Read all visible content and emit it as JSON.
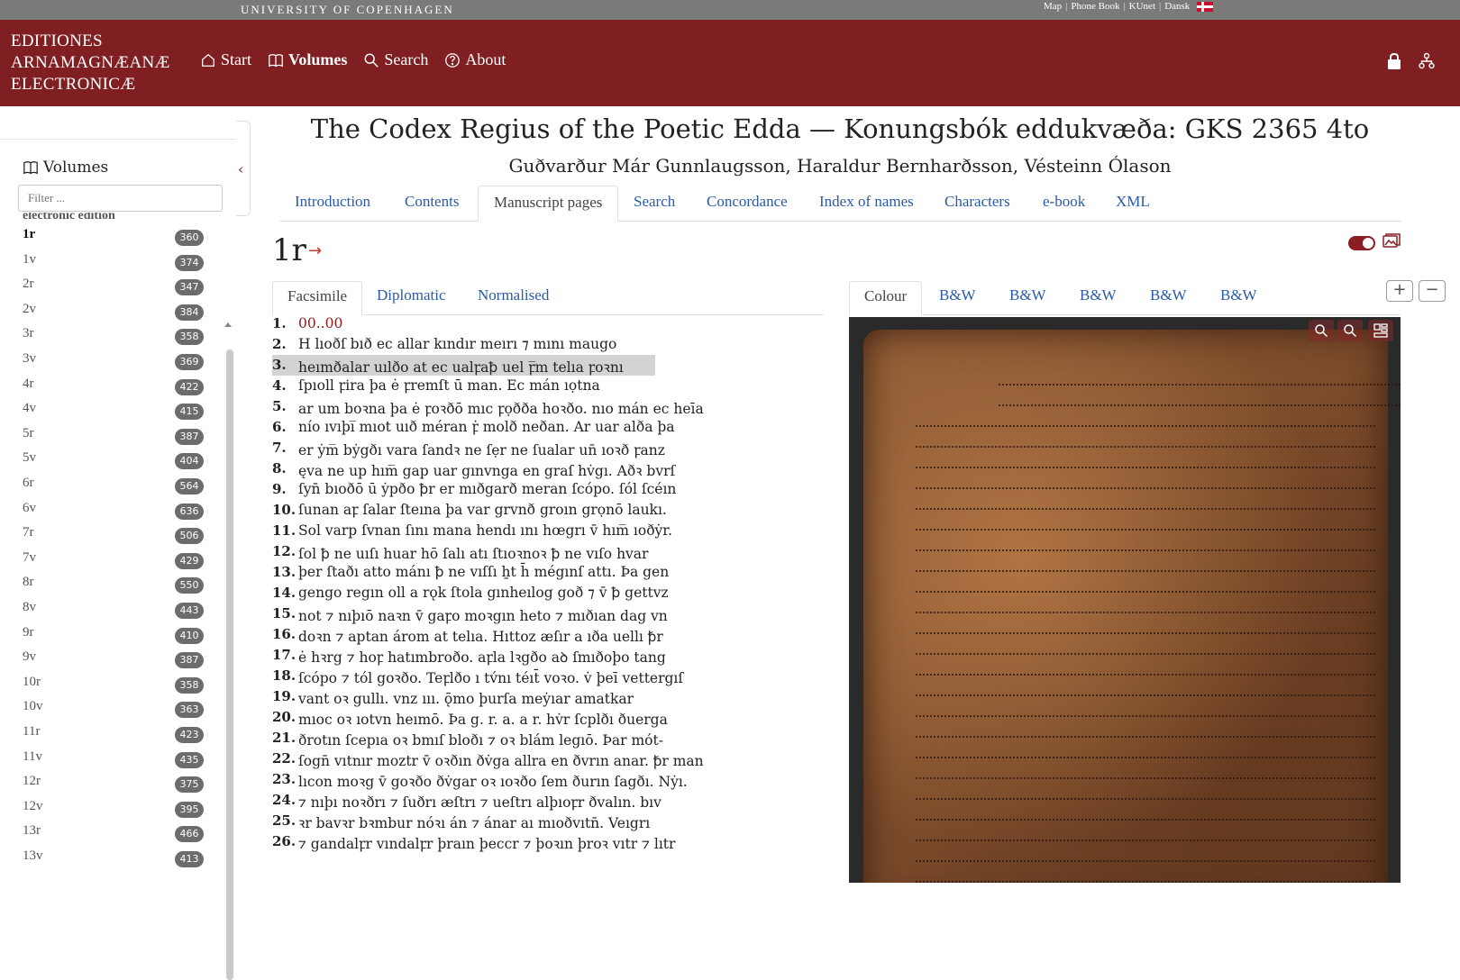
{
  "top": {
    "university": "UNIVERSITY OF COPENHAGEN",
    "links": [
      "Map",
      "Phone Book",
      "KUnet",
      "Dansk"
    ]
  },
  "header": {
    "brand_lines": [
      "EDITIONES",
      "ARNAMAGNÆANÆ",
      "ELECTRONICÆ"
    ],
    "nav": [
      "Start",
      "Volumes",
      "Search",
      "About"
    ]
  },
  "sidebar": {
    "title": "Volumes",
    "filter_placeholder": "Filter ...",
    "section": "electronic edition",
    "pages": [
      {
        "label": "1r",
        "count": "360"
      },
      {
        "label": "1v",
        "count": "374"
      },
      {
        "label": "2r",
        "count": "347"
      },
      {
        "label": "2v",
        "count": "384"
      },
      {
        "label": "3r",
        "count": "358"
      },
      {
        "label": "3v",
        "count": "369"
      },
      {
        "label": "4r",
        "count": "422"
      },
      {
        "label": "4v",
        "count": "415"
      },
      {
        "label": "5r",
        "count": "387"
      },
      {
        "label": "5v",
        "count": "404"
      },
      {
        "label": "6r",
        "count": "564"
      },
      {
        "label": "6v",
        "count": "636"
      },
      {
        "label": "7r",
        "count": "506"
      },
      {
        "label": "7v",
        "count": "429"
      },
      {
        "label": "8r",
        "count": "550"
      },
      {
        "label": "8v",
        "count": "443"
      },
      {
        "label": "9r",
        "count": "410"
      },
      {
        "label": "9v",
        "count": "387"
      },
      {
        "label": "10r",
        "count": "358"
      },
      {
        "label": "10v",
        "count": "363"
      },
      {
        "label": "11r",
        "count": "423"
      },
      {
        "label": "11v",
        "count": "435"
      },
      {
        "label": "12r",
        "count": "375"
      },
      {
        "label": "12v",
        "count": "395"
      },
      {
        "label": "13r",
        "count": "466"
      },
      {
        "label": "13v",
        "count": "413"
      }
    ]
  },
  "document": {
    "title": "The Codex Regius of the Poetic Edda — Konungsbók eddukvæða: GKS 2365 4to",
    "authors": "Guðvarður Már Gunnlaugsson, Haraldur Bernharðsson, Vésteinn Ólason",
    "tabs": [
      "Introduction",
      "Contents",
      "Manuscript pages",
      "Search",
      "Concordance",
      "Index of names",
      "Characters",
      "e-book",
      "XML"
    ],
    "page": "1r",
    "page_arrow": "→",
    "text_tabs": [
      "Facsimile",
      "Diplomatic",
      "Normalised"
    ],
    "image_tabs": [
      "Colour",
      "B&W",
      "B&W",
      "B&W",
      "B&W",
      "B&W"
    ],
    "zoom_in": "+",
    "zoom_out": "−"
  },
  "lines": [
    {
      "n": "1.",
      "t": "00..00"
    },
    {
      "n": "2.",
      "t": "H lıoðſ bıð ec allar kındır meırı ⁊ mını maugo"
    },
    {
      "n": "3.",
      "t": "heımðalar uılðo at ec ualꝼaꝥ uel ꝼ̅m telıa ꝼoꝛnı"
    },
    {
      "n": "4.",
      "t": "ſpıoll ꝼira þa ė ꝼremſt ū man. Ec mán ıọtna"
    },
    {
      "n": "5.",
      "t": "ar um boꝛna þa ė ꝼoꝛðō mıc ꝼọðða hoꝛðo. nıo mán ec heīa"
    },
    {
      "n": "6.",
      "t": "nío ıvıþı̅ mıot uıð méran ꝼ̇ molð neðan. Ar uar alða þa"
    },
    {
      "n": "7.",
      "t": "er ẏm̅ bẏgðı vara ſandꝛ ne ſẹr ne ſualar un̄ ıoꝛð ꝼanz"
    },
    {
      "n": "8.",
      "t": "ęva ne up hım̅ gap uar gınvnga en graſ hv̇gı. Aðꝛ bvrſ"
    },
    {
      "n": "9.",
      "t": "ſyn̄ bıoðō ū ẏpðo ꝥr er mıðgarð meran ſcópo. ſól ſcéın"
    },
    {
      "n": "10.",
      "t": "ſunan aꝼ ſalar ſteına þa var grvnð groın grọnō laukı."
    },
    {
      "n": "11.",
      "t": "Sol varp ſvnan ſını mana hendı ını hœgrı v̄ hım̅ ıoðẏr."
    },
    {
      "n": "12.",
      "t": "ſol ꝥ ne uıſı huar hō ſalı atı ſtıoꝛnoꝛ ꝥ ne vıſo hvar"
    },
    {
      "n": "13.",
      "t": "þer ſtaðı atto mánı ꝥ ne vıſſı ẖt h̄ mégınſ attı. Þa gen"
    },
    {
      "n": "14.",
      "t": "gengo regın oll a rǫk ſtola gınheılog goð ⁊ v̄ ꝥ gettvz"
    },
    {
      "n": "15.",
      "t": "not ⁊ nıþıō naꝛn v̄ gaꝼo moꝛgın heto ⁊ mıðıan dag vn"
    },
    {
      "n": "16.",
      "t": "doꝛn ⁊ aptan árom at telıa. Hıttoz æſır a ıða uellı ꝥr"
    },
    {
      "n": "17.",
      "t": "ė hꝛrg ⁊ hoꝼ hatımbroðo. aꝼla lꝛgðo aꝺ ſmıðoþo tang"
    },
    {
      "n": "18.",
      "t": "ſcópo ⁊ tól goꝛðo. Teꝼlðo ı tv́nı téıt̄ voꝛo. v̇ þeī vettergıſ"
    },
    {
      "n": "19.",
      "t": "vant oꝛ gullı. vnz ııı. ǭmo þurſa meẏıar amatkar"
    },
    {
      "n": "20.",
      "t": "mıoc oꝛ ıotvn heımō. Þa g. r. a. a r. hv̇r ſcplðı ðuerga"
    },
    {
      "n": "21.",
      "t": "ðrotın ſcepıa oꝛ bmıſ bloðı ⁊ oꝛ blám legıō. Þar mót-"
    },
    {
      "n": "22.",
      "t": "ſogn̄ vıtnır moztr v̄ oꝛðın ðv̇ga allra en ðvrın anar. ꝥr man"
    },
    {
      "n": "23.",
      "t": "lıcon moꝛg v̄ goꝛðo ðv̇gar oꝛ ıoꝛðo ſem ðurın ſagðı. Nẏı."
    },
    {
      "n": "24.",
      "t": "⁊ nıþı noꝛðrı ⁊ ſuðrı æſtrı ⁊ ueſtrı alþıoꝼr ðvalın. bıv"
    },
    {
      "n": "25.",
      "t": "ꝛr bavꝛr bꝛmbur nóꝛı án ⁊ ánar aı mıoðvıtn̄. Veıgrı"
    },
    {
      "n": "26.",
      "t": "⁊ gandalꝼr vındalꝼr þraın þeccr ⁊ þoꝛın þroꝛ vıtr ⁊ lıtr"
    }
  ]
}
